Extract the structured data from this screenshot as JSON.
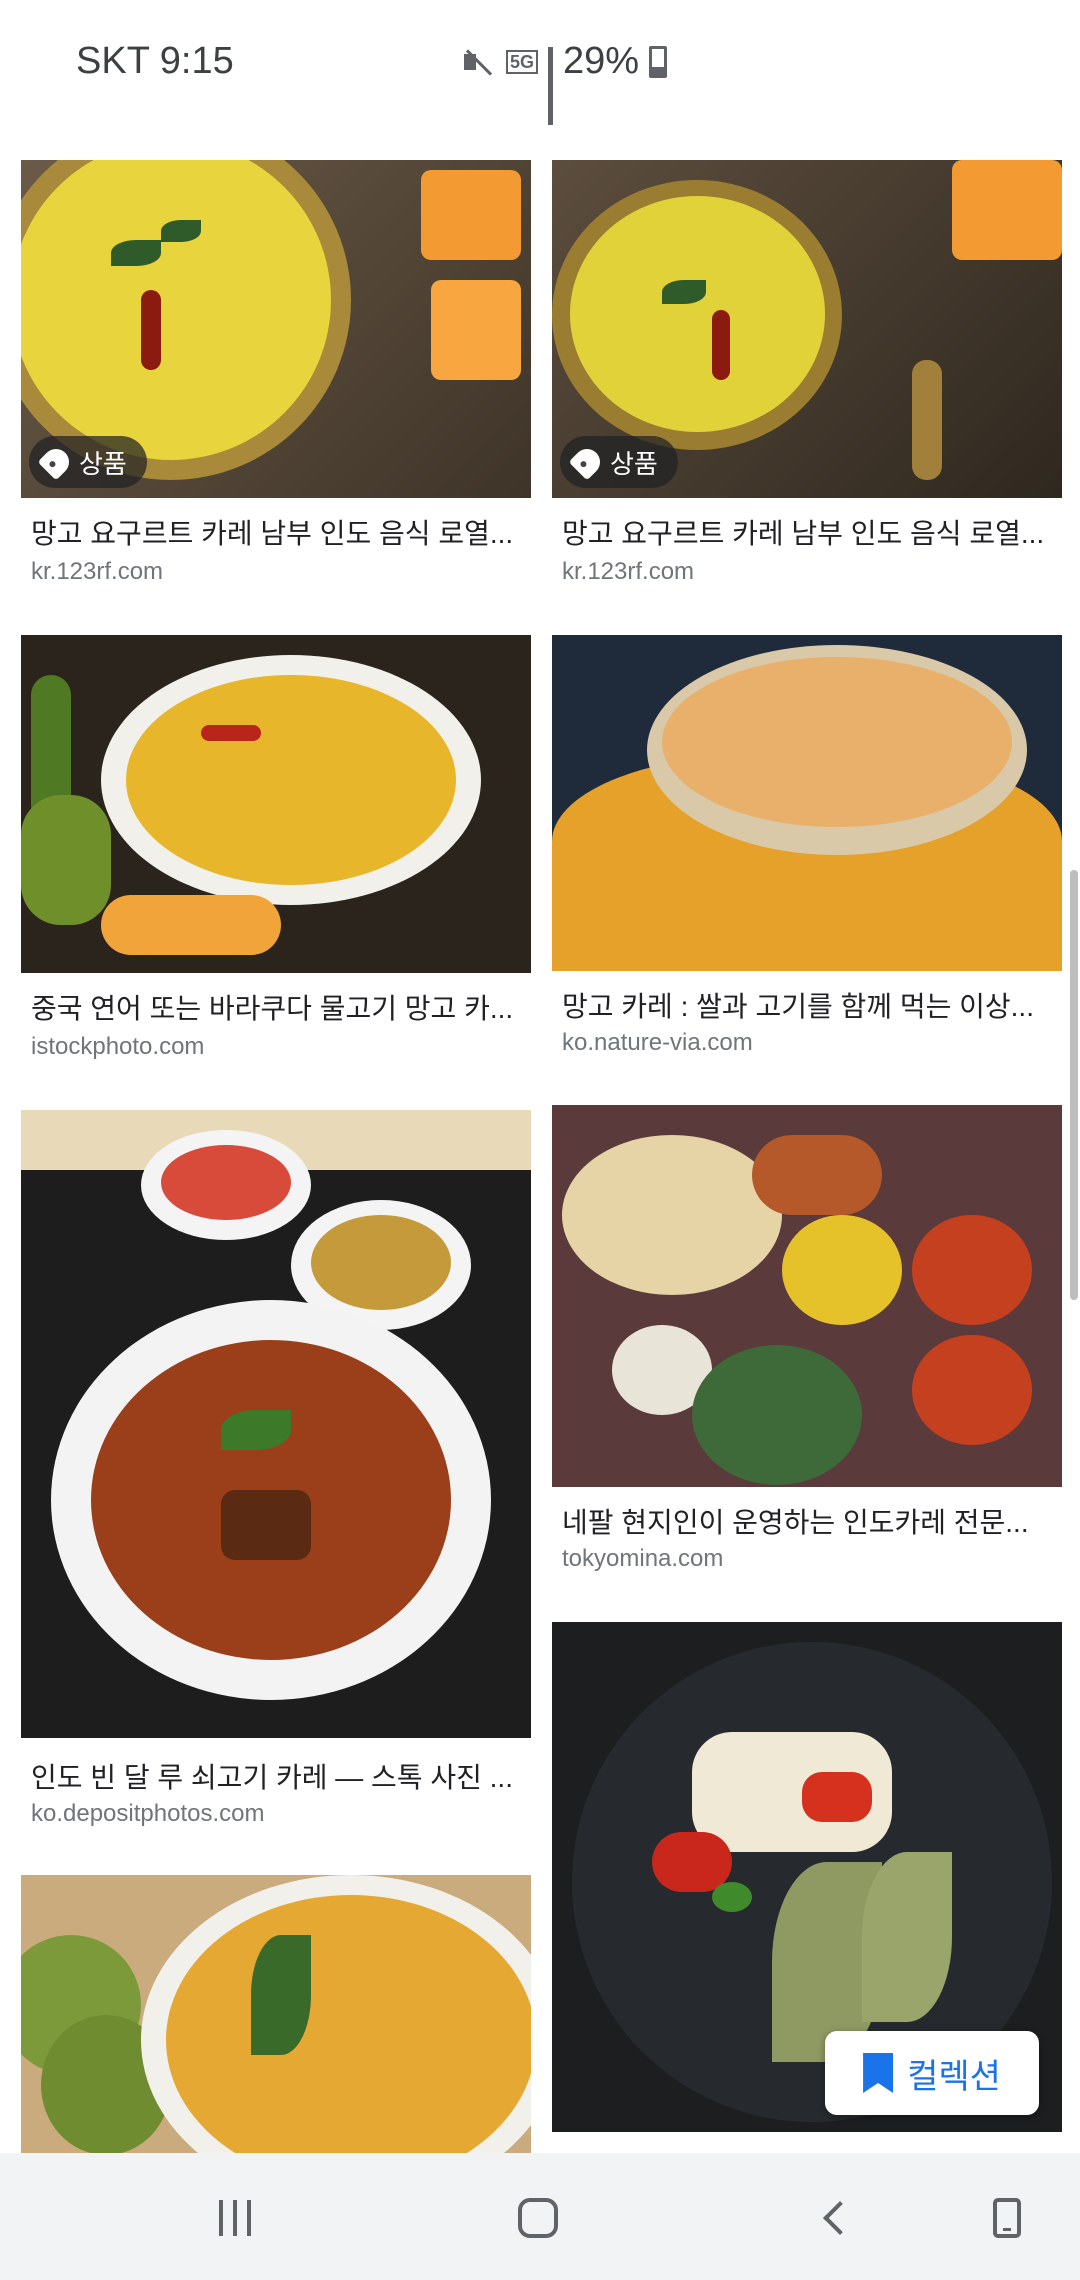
{
  "status_bar": {
    "carrier_time": "SKT 9:15",
    "network": "5G",
    "battery": "29%"
  },
  "results": [
    {
      "title": "망고 요구르트 카레 남부 인도 음식 로열...",
      "source": "kr.123rf.com",
      "badge": "상품"
    },
    {
      "title": "망고 요구르트 카레 남부 인도 음식 로열...",
      "source": "kr.123rf.com",
      "badge": "상품"
    },
    {
      "title": "중국 연어 또는 바라쿠다 물고기 망고 카...",
      "source": "istockphoto.com"
    },
    {
      "title": "망고 카레 : 쌀과 고기를 함께 먹는 이상...",
      "source": "ko.nature-via.com"
    },
    {
      "title": "인도 빈 달 루 쇠고기 카레 — 스톡 사진 ...",
      "source": "ko.depositphotos.com"
    },
    {
      "title": "네팔 현지인이 운영하는 인도카레 전문...",
      "source": "tokyomina.com"
    },
    {
      "title": "",
      "source": ""
    },
    {
      "title": "",
      "source": ""
    }
  ],
  "collection_button": {
    "label": "컬렉션"
  },
  "colors": {
    "accent": "#1a73e8",
    "nav_bg": "#f1f3f4"
  }
}
